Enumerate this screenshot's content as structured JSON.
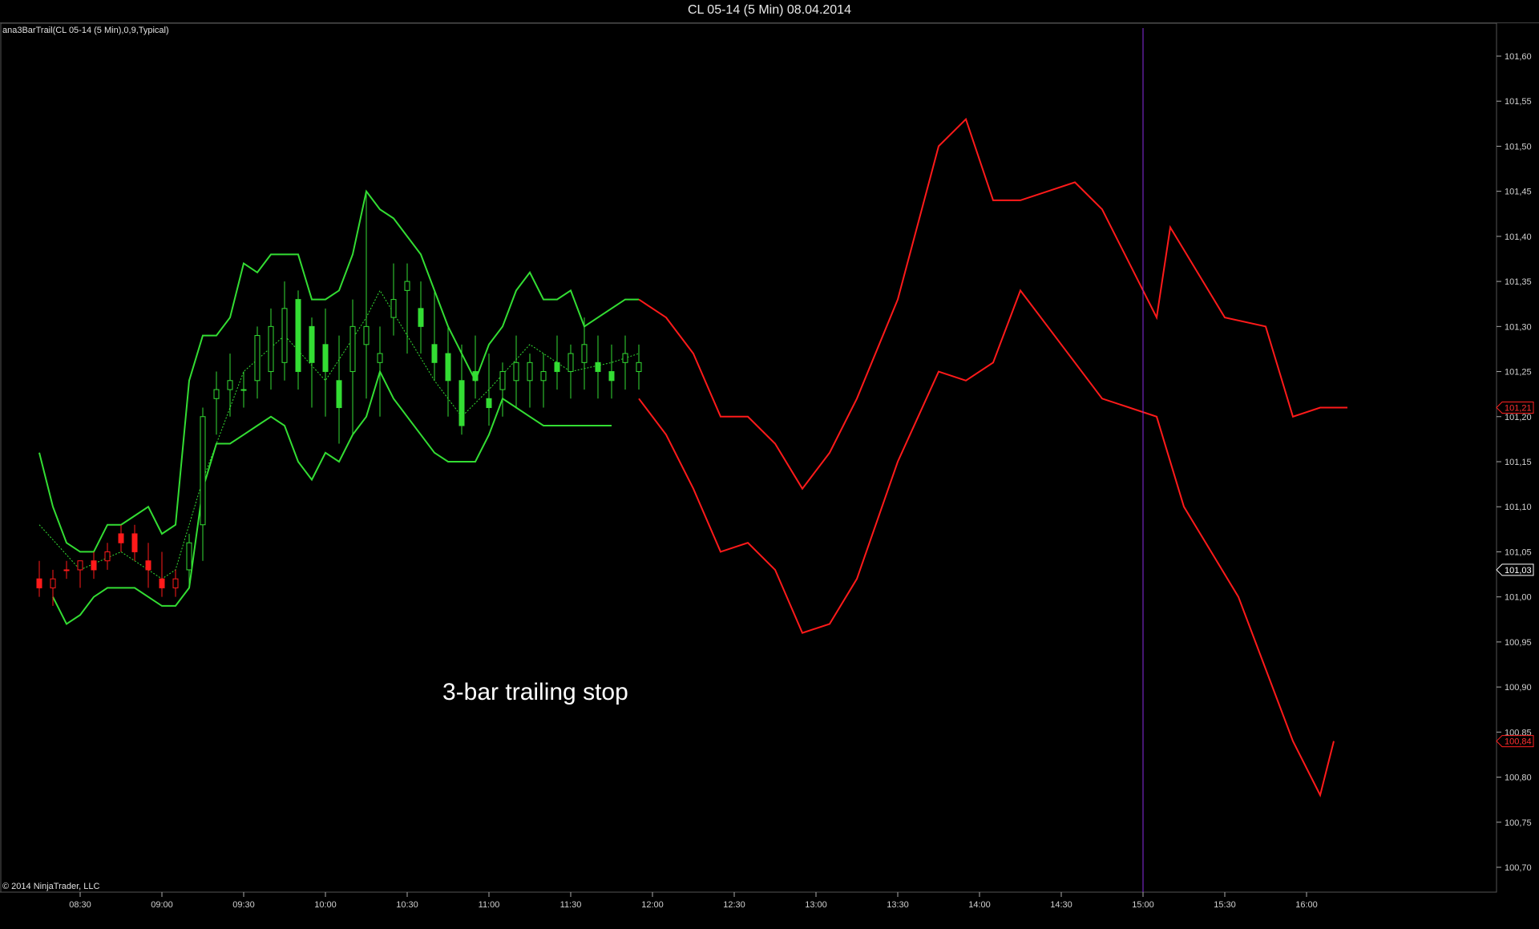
{
  "window": {
    "title": "CL 05-14 (5 Min)  08.04.2014",
    "indicator_label": "ana3BarTrail(CL 05-14 (5 Min),0,9,Typical)",
    "copyright": "© 2014 NinjaTrader, LLC",
    "annotation": "3-bar trailing stop"
  },
  "colors": {
    "up": "#33dd33",
    "down": "#ff1a1a",
    "cursor_line": "#8a2be2",
    "background": "#000000",
    "axis_text": "#d0d0d0"
  },
  "chart_data": {
    "type": "candlestick",
    "title": "CL 05-14 (5 Min)  08.04.2014",
    "interval_minutes": 5,
    "x_tick_labels": [
      "08:30",
      "09:00",
      "09:30",
      "10:00",
      "10:30",
      "11:00",
      "11:30",
      "12:00",
      "12:30",
      "13:00",
      "13:30",
      "14:00",
      "14:30",
      "15:00",
      "15:30",
      "16:00"
    ],
    "y_tick_labels": [
      "100,70",
      "100,75",
      "100,80",
      "100,85",
      "100,90",
      "100,95",
      "101,00",
      "101,05",
      "101,10",
      "101,15",
      "101,20",
      "101,25",
      "101,30",
      "101,35",
      "101,40",
      "101,45",
      "101,50",
      "101,55",
      "101,60"
    ],
    "ylim": [
      100.66,
      101.63
    ],
    "xlim": [
      "08:15",
      "16:45"
    ],
    "vertical_marker_time": "15:00",
    "price_tags": [
      {
        "value": "101,21",
        "style": "red"
      },
      {
        "value": "101,03",
        "style": "white"
      },
      {
        "value": "100,84",
        "style": "red"
      }
    ],
    "series": [
      {
        "name": "trail_upper",
        "role": "upper_band",
        "points": [
          [
            "08:15",
            101.16
          ],
          [
            "08:20",
            101.1
          ],
          [
            "08:25",
            101.06
          ],
          [
            "08:30",
            101.05
          ],
          [
            "08:35",
            101.05
          ],
          [
            "08:40",
            101.08
          ],
          [
            "08:45",
            101.08
          ],
          [
            "08:50",
            101.09
          ],
          [
            "08:55",
            101.1
          ],
          [
            "09:00",
            101.07
          ],
          [
            "09:05",
            101.08
          ],
          [
            "09:10",
            101.24
          ],
          [
            "09:15",
            101.29
          ],
          [
            "09:20",
            101.29
          ],
          [
            "09:25",
            101.31
          ],
          [
            "09:30",
            101.37
          ],
          [
            "09:35",
            101.36
          ],
          [
            "09:40",
            101.38
          ],
          [
            "09:45",
            101.38
          ],
          [
            "09:50",
            101.38
          ],
          [
            "09:55",
            101.33
          ],
          [
            "10:00",
            101.33
          ],
          [
            "10:05",
            101.34
          ],
          [
            "10:10",
            101.38
          ],
          [
            "10:15",
            101.45
          ],
          [
            "10:20",
            101.43
          ],
          [
            "10:25",
            101.42
          ],
          [
            "10:30",
            101.4
          ],
          [
            "10:35",
            101.38
          ],
          [
            "10:40",
            101.34
          ],
          [
            "10:45",
            101.3
          ],
          [
            "10:50",
            101.27
          ],
          [
            "10:55",
            101.24
          ],
          [
            "11:00",
            101.28
          ],
          [
            "11:05",
            101.3
          ],
          [
            "11:10",
            101.34
          ],
          [
            "11:15",
            101.36
          ],
          [
            "11:20",
            101.33
          ],
          [
            "11:25",
            101.33
          ],
          [
            "11:30",
            101.34
          ],
          [
            "11:35",
            101.3
          ],
          [
            "11:40",
            101.31
          ],
          [
            "11:45",
            101.32
          ],
          [
            "11:50",
            101.33
          ],
          [
            "11:55",
            101.33
          ]
        ]
      },
      {
        "name": "trail_lower",
        "role": "lower_band",
        "points": [
          [
            "08:20",
            101.0
          ],
          [
            "08:25",
            100.97
          ],
          [
            "08:30",
            100.98
          ],
          [
            "08:35",
            101.0
          ],
          [
            "08:40",
            101.01
          ],
          [
            "08:45",
            101.01
          ],
          [
            "08:50",
            101.01
          ],
          [
            "08:55",
            101.0
          ],
          [
            "09:00",
            100.99
          ],
          [
            "09:05",
            100.99
          ],
          [
            "09:10",
            101.01
          ],
          [
            "09:15",
            101.12
          ],
          [
            "09:20",
            101.17
          ],
          [
            "09:25",
            101.17
          ],
          [
            "09:30",
            101.18
          ],
          [
            "09:35",
            101.19
          ],
          [
            "09:40",
            101.2
          ],
          [
            "09:45",
            101.19
          ],
          [
            "09:50",
            101.15
          ],
          [
            "09:55",
            101.13
          ],
          [
            "10:00",
            101.16
          ],
          [
            "10:05",
            101.15
          ],
          [
            "10:10",
            101.18
          ],
          [
            "10:15",
            101.2
          ],
          [
            "10:20",
            101.25
          ],
          [
            "10:25",
            101.22
          ],
          [
            "10:30",
            101.2
          ],
          [
            "10:35",
            101.18
          ],
          [
            "10:40",
            101.16
          ],
          [
            "10:45",
            101.15
          ],
          [
            "10:50",
            101.15
          ],
          [
            "10:55",
            101.15
          ],
          [
            "11:00",
            101.18
          ],
          [
            "11:05",
            101.22
          ],
          [
            "11:10",
            101.21
          ],
          [
            "11:15",
            101.2
          ],
          [
            "11:20",
            101.19
          ],
          [
            "11:25",
            101.19
          ],
          [
            "11:30",
            101.19
          ],
          [
            "11:35",
            101.19
          ],
          [
            "11:40",
            101.19
          ],
          [
            "11:45",
            101.19
          ]
        ]
      },
      {
        "name": "trail_mid",
        "role": "mid_dotted",
        "points": [
          [
            "08:15",
            101.08
          ],
          [
            "08:30",
            101.03
          ],
          [
            "08:45",
            101.05
          ],
          [
            "09:00",
            101.02
          ],
          [
            "09:05",
            101.03
          ],
          [
            "09:15",
            101.13
          ],
          [
            "09:30",
            101.25
          ],
          [
            "09:45",
            101.29
          ],
          [
            "10:00",
            101.24
          ],
          [
            "10:15",
            101.31
          ],
          [
            "10:20",
            101.34
          ],
          [
            "10:30",
            101.29
          ],
          [
            "10:40",
            101.24
          ],
          [
            "10:50",
            101.2
          ],
          [
            "11:00",
            101.23
          ],
          [
            "11:15",
            101.28
          ],
          [
            "11:30",
            101.25
          ],
          [
            "11:45",
            101.26
          ],
          [
            "11:55",
            101.27
          ]
        ]
      },
      {
        "name": "candles",
        "role": "ohlc",
        "values": [
          [
            "08:15",
            101.02,
            101.04,
            101.0,
            101.01
          ],
          [
            "08:20",
            101.01,
            101.03,
            100.99,
            101.02
          ],
          [
            "08:25",
            101.03,
            101.04,
            101.02,
            101.03
          ],
          [
            "08:30",
            101.03,
            101.04,
            101.01,
            101.04
          ],
          [
            "08:35",
            101.04,
            101.05,
            101.02,
            101.03
          ],
          [
            "08:40",
            101.04,
            101.06,
            101.03,
            101.05
          ],
          [
            "08:45",
            101.07,
            101.08,
            101.05,
            101.06
          ],
          [
            "08:50",
            101.07,
            101.08,
            101.04,
            101.05
          ],
          [
            "08:55",
            101.04,
            101.06,
            101.01,
            101.03
          ],
          [
            "09:00",
            101.02,
            101.05,
            101.0,
            101.01
          ],
          [
            "09:05",
            101.01,
            101.03,
            101.0,
            101.02
          ],
          [
            "09:10",
            101.03,
            101.07,
            101.01,
            101.06
          ],
          [
            "09:15",
            101.08,
            101.21,
            101.04,
            101.2
          ],
          [
            "09:20",
            101.22,
            101.25,
            101.18,
            101.23
          ],
          [
            "09:25",
            101.23,
            101.27,
            101.2,
            101.24
          ],
          [
            "09:30",
            101.23,
            101.25,
            101.21,
            101.23
          ],
          [
            "09:35",
            101.24,
            101.3,
            101.22,
            101.29
          ],
          [
            "09:40",
            101.25,
            101.32,
            101.23,
            101.3
          ],
          [
            "09:45",
            101.26,
            101.35,
            101.24,
            101.32
          ],
          [
            "09:50",
            101.33,
            101.34,
            101.23,
            101.25
          ],
          [
            "09:55",
            101.3,
            101.31,
            101.21,
            101.26
          ],
          [
            "10:00",
            101.28,
            101.32,
            101.2,
            101.25
          ],
          [
            "10:05",
            101.24,
            101.29,
            101.17,
            101.21
          ],
          [
            "10:10",
            101.25,
            101.33,
            101.18,
            101.3
          ],
          [
            "10:15",
            101.28,
            101.45,
            101.22,
            101.3
          ],
          [
            "10:20",
            101.26,
            101.3,
            101.2,
            101.27
          ],
          [
            "10:25",
            101.31,
            101.37,
            101.29,
            101.33
          ],
          [
            "10:30",
            101.34,
            101.37,
            101.27,
            101.35
          ],
          [
            "10:35",
            101.32,
            101.35,
            101.27,
            101.3
          ],
          [
            "10:40",
            101.28,
            101.34,
            101.24,
            101.26
          ],
          [
            "10:45",
            101.27,
            101.3,
            101.2,
            101.24
          ],
          [
            "10:50",
            101.24,
            101.28,
            101.18,
            101.19
          ],
          [
            "10:55",
            101.25,
            101.29,
            101.22,
            101.24
          ],
          [
            "11:00",
            101.22,
            101.27,
            101.19,
            101.21
          ],
          [
            "11:05",
            101.23,
            101.26,
            101.2,
            101.25
          ],
          [
            "11:10",
            101.24,
            101.29,
            101.21,
            101.26
          ],
          [
            "11:15",
            101.24,
            101.27,
            101.21,
            101.26
          ],
          [
            "11:20",
            101.24,
            101.27,
            101.21,
            101.25
          ],
          [
            "11:25",
            101.26,
            101.29,
            101.23,
            101.25
          ],
          [
            "11:30",
            101.25,
            101.28,
            101.22,
            101.27
          ],
          [
            "11:35",
            101.26,
            101.31,
            101.23,
            101.28
          ],
          [
            "11:40",
            101.26,
            101.29,
            101.22,
            101.25
          ],
          [
            "11:45",
            101.25,
            101.28,
            101.22,
            101.24
          ],
          [
            "11:50",
            101.26,
            101.29,
            101.23,
            101.27
          ],
          [
            "11:55",
            101.25,
            101.28,
            101.23,
            101.26
          ]
        ]
      }
    ]
  }
}
